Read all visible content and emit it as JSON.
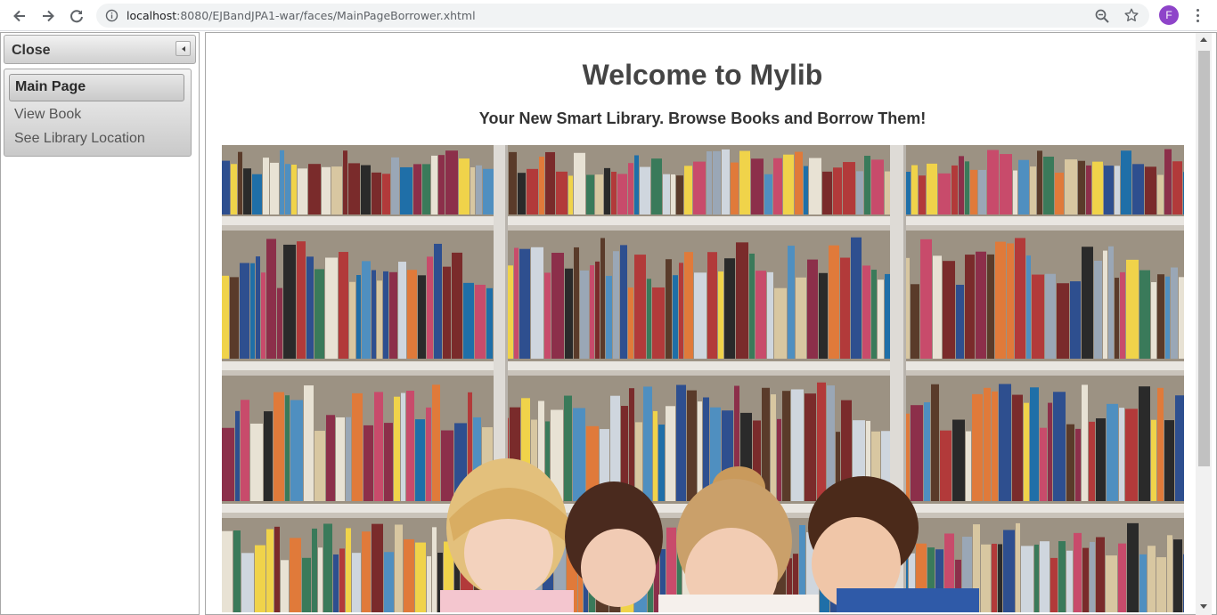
{
  "browser": {
    "url_host": "localhost",
    "url_path": ":8080/EJBandJPA1-war/faces/MainPageBorrower.xhtml",
    "profile_initial": "F",
    "profile_color": "#8e44c9"
  },
  "sidebar": {
    "header_title": "Close",
    "items": [
      {
        "label": "Main Page",
        "active": true
      },
      {
        "label": "View Book",
        "active": false
      },
      {
        "label": "See Library Location",
        "active": false
      }
    ]
  },
  "main": {
    "title": "Welcome to Mylib",
    "subtitle": "Your New Smart Library. Browse Books and Borrow Them!",
    "hero_image": "library-bookshelves-with-teacher-and-children-reading"
  },
  "icons": {
    "back": "back-arrow-icon",
    "forward": "forward-arrow-icon",
    "reload": "reload-icon",
    "info": "info-icon",
    "zoom": "zoom-icon",
    "bookmark": "star-icon",
    "menu": "kebab-menu-icon"
  }
}
